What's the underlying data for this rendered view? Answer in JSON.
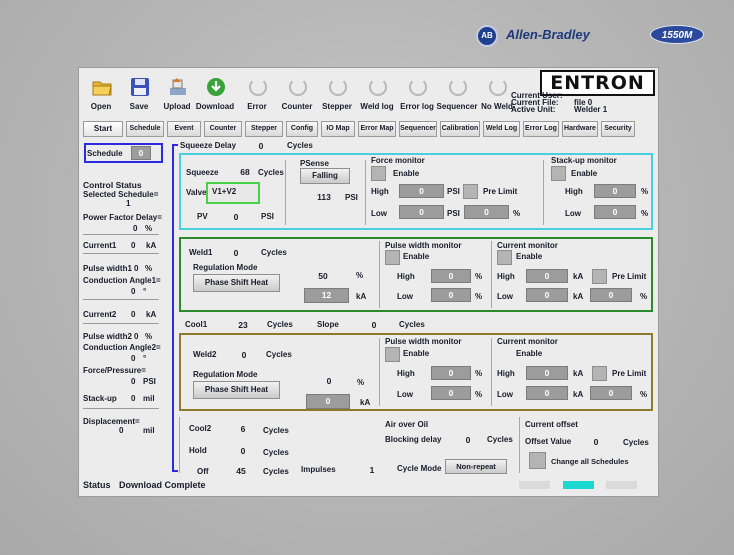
{
  "brand": {
    "ab_logo": "AB",
    "ab_name": "Allen-Bradley",
    "model_badge": "1550M",
    "entron_logo": "ENTRON"
  },
  "toolbar": [
    {
      "label": "Open",
      "icon": "folder-open-icon"
    },
    {
      "label": "Save",
      "icon": "floppy-disk-icon"
    },
    {
      "label": "Upload",
      "icon": "upload-icon"
    },
    {
      "label": "Download",
      "icon": "download-icon"
    },
    {
      "label": "Error",
      "icon": "loading-circle-icon"
    },
    {
      "label": "Counter",
      "icon": "loading-circle-icon"
    },
    {
      "label": "Stepper",
      "icon": "loading-circle-icon"
    },
    {
      "label": "Weld log",
      "icon": "loading-circle-icon"
    },
    {
      "label": "Error log",
      "icon": "loading-circle-icon"
    },
    {
      "label": "Sequencer",
      "icon": "loading-circle-icon"
    },
    {
      "label": "No Weld",
      "icon": "loading-circle-icon"
    }
  ],
  "info": {
    "current_user_label": "Current User:",
    "current_file_label": "Current File:",
    "current_file_value": "file 0",
    "active_unit_label": "Active Unit:",
    "active_unit_value": "Welder 1"
  },
  "tabs": [
    "Start",
    "Schedule",
    "Event",
    "Counter",
    "Stepper",
    "Config",
    "IO Map",
    "Error Map",
    "Sequencer",
    "Calibration",
    "Weld Log",
    "Error Log",
    "Hardware",
    "Security"
  ],
  "left": {
    "schedule_label": "Schedule",
    "schedule_value": "0",
    "control_status": "Control Status",
    "selected_schedule_label": "Selected Schedule=",
    "selected_schedule_value": "1",
    "pf_delay_label": "Power Factor Delay=",
    "pf_delay_value": "0",
    "pf_delay_unit": "%",
    "current1_label": "Current1",
    "current1_value": "0",
    "current1_unit": "kA",
    "pw1_label": "Pulse width1",
    "pw1_value": "0",
    "pw1_unit": "%",
    "ca1_label": "Conduction Angle1=",
    "ca1_value": "0",
    "ca1_unit": "°",
    "current2_label": "Current2",
    "current2_value": "0",
    "current2_unit": "kA",
    "pw2_label": "Pulse width2",
    "pw2_value": "0",
    "pw2_unit": "%",
    "ca2_label": "Conduction Angle2=",
    "ca2_value": "0",
    "ca2_unit": "°",
    "force_label": "Force/Pressure=",
    "force_value": "0",
    "force_unit": "PSI",
    "stackup_label": "Stack-up",
    "stackup_value": "0",
    "stackup_unit": "mil",
    "disp_label": "Displacement=",
    "disp_value": "0",
    "disp_unit": "mil"
  },
  "squeeze": {
    "sq_delay_label": "Squeeze Delay",
    "sq_delay_value": "0",
    "sq_delay_unit": "Cycles",
    "squeeze_label": "Squeeze",
    "squeeze_value": "68",
    "squeeze_unit": "Cycles",
    "valve_label": "Valve",
    "valve_value": "V1+V2",
    "pv_label": "PV",
    "pv_value": "0",
    "pv_unit": "PSI",
    "psense_label": "PSense",
    "psense_button": "Falling",
    "psense_value": "113",
    "psense_unit": "PSI",
    "force_monitor": "Force monitor",
    "enable": "Enable",
    "high": "High",
    "high_value": "0",
    "high_unit": "PSI",
    "pre_limit": "Pre Limit",
    "low": "Low",
    "low_value": "0",
    "low_unit": "PSI",
    "pct_value": "0",
    "pct_unit": "%",
    "stackup_monitor": "Stack-up monitor",
    "su_enable": "Enable",
    "su_high": "High",
    "su_high_value": "0",
    "su_high_unit": "%",
    "su_low": "Low",
    "su_low_value": "0",
    "su_low_unit": "%"
  },
  "weld1": {
    "label": "Weld1",
    "value": "0",
    "unit": "Cycles",
    "reg_mode": "Regulation Mode",
    "reg_button": "Phase Shift Heat",
    "pct_value": "50",
    "pct_unit": "%",
    "ka_value": "12",
    "ka_unit": "kA",
    "pw_monitor": "Pulse width monitor",
    "pw_enable": "Enable",
    "pw_high": "High",
    "pw_high_value": "0",
    "pw_high_unit": "%",
    "pw_low": "Low",
    "pw_low_value": "0",
    "pw_low_unit": "%",
    "cur_monitor": "Current monitor",
    "cur_enable": "Enable",
    "cur_high": "High",
    "cur_high_value": "0",
    "cur_high_unit": "kA",
    "cur_pre_limit": "Pre Limit",
    "cur_low": "Low",
    "cur_low_value": "0",
    "cur_low_unit": "kA",
    "cur_pct_value": "0",
    "cur_pct_unit": "%"
  },
  "cool1": {
    "label": "Cool1",
    "value": "23",
    "unit": "Cycles",
    "slope_label": "Slope",
    "slope_value": "0",
    "slope_unit": "Cycles"
  },
  "weld2": {
    "label": "Weld2",
    "value": "0",
    "unit": "Cycles",
    "reg_mode": "Regulation Mode",
    "reg_button": "Phase Shift Heat",
    "pct_value": "0",
    "pct_unit": "%",
    "ka_value": "0",
    "ka_unit": "kA",
    "pw_monitor": "Pulse width monitor",
    "pw_enable": "Enable",
    "pw_high": "High",
    "pw_high_value": "0",
    "pw_high_unit": "%",
    "pw_low": "Low",
    "pw_low_value": "0",
    "pw_low_unit": "%",
    "cur_monitor": "Current monitor",
    "cur_enable": "Enable",
    "cur_high": "High",
    "cur_high_value": "0",
    "cur_high_unit": "kA",
    "cur_pre_limit": "Pre Limit",
    "cur_low": "Low",
    "cur_low_value": "0",
    "cur_low_unit": "kA",
    "cur_pct_value": "0",
    "cur_pct_unit": "%"
  },
  "bottom": {
    "cool2_label": "Cool2",
    "cool2_value": "6",
    "cool2_unit": "Cycles",
    "hold_label": "Hold",
    "hold_value": "0",
    "hold_unit": "Cycles",
    "off_label": "Off",
    "off_value": "45",
    "off_unit": "Cycles",
    "impulses_label": "Impulses",
    "impulses_value": "1",
    "air_over_oil": "Air over Oil",
    "blocking_label": "Blocking delay",
    "blocking_value": "0",
    "blocking_unit": "Cycles",
    "cycle_mode_label": "Cycle Mode",
    "cycle_mode_value": "Non-repeat",
    "current_offset": "Current offset",
    "offset_value_label": "Offset Value",
    "offset_value": "0",
    "offset_unit": "Cycles",
    "change_all": "Change all Schedules"
  },
  "status": {
    "label": "Status",
    "text": "Download Complete"
  },
  "colors": {
    "cyan": "#4ad0dc",
    "green": "#2c8a2c",
    "olive": "#8f7a2c",
    "blue": "#2a2ae0",
    "status_indicator": "#1ad7d0"
  }
}
